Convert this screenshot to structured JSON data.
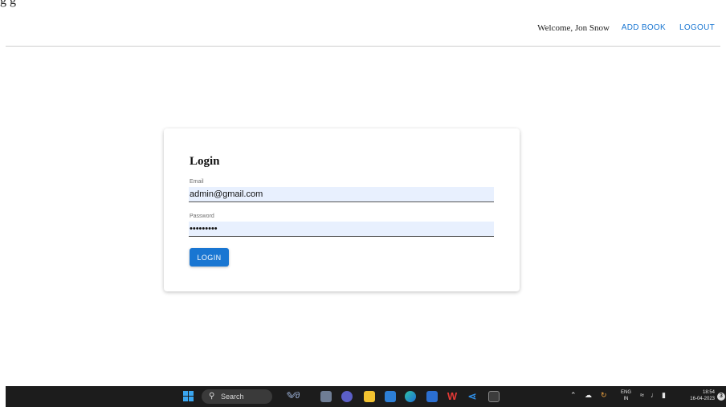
{
  "browser": {
    "partial_title": "g                                                                g"
  },
  "navbar": {
    "welcome": "Welcome, Jon Snow",
    "add_book": "ADD BOOK",
    "logout": "LOGOUT",
    "link_color": "#1976d2"
  },
  "login_card": {
    "title": "Login",
    "email_label": "Email",
    "email_value": "admin@gmail.com",
    "password_label": "Password",
    "password_value": "•••••••••",
    "button_label": "LOGIN",
    "button_color": "#1976d2",
    "input_fill_color": "#e8f0fe"
  },
  "taskbar": {
    "search_label": "Search",
    "apps": [
      "widgets-icon",
      "task-view-icon",
      "teams-chat-icon",
      "file-explorer-icon",
      "mail-icon",
      "edge-browser-icon",
      "word-icon",
      "wps-office-icon",
      "vscode-icon",
      "terminal-icon"
    ],
    "tray": {
      "language_line1": "ENG",
      "language_line2": "IN",
      "time": "18:54",
      "date": "16-04-2023",
      "notification_count": "3"
    }
  }
}
